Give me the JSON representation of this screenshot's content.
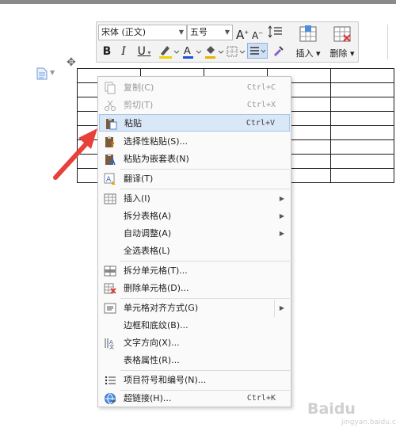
{
  "toolbar": {
    "font_name": "宋体 (正文)",
    "font_size": "五号",
    "grow_font": "A",
    "shrink_font": "A",
    "bold": "B",
    "italic": "I",
    "underline": "U",
    "insert_label": "插入",
    "delete_label": "删除"
  },
  "context_menu": {
    "copy": {
      "label": "复制(C)",
      "shortcut": "Ctrl+C"
    },
    "cut": {
      "label": "剪切(T)",
      "shortcut": "Ctrl+X"
    },
    "paste": {
      "label": "粘贴",
      "shortcut": "Ctrl+V"
    },
    "paste_special": {
      "label": "选择性粘贴(S)..."
    },
    "paste_nested": {
      "label": "粘贴为嵌套表(N)"
    },
    "translate": {
      "label": "翻译(T)"
    },
    "insert": {
      "label": "插入(I)"
    },
    "split_table": {
      "label": "拆分表格(A)"
    },
    "autofit": {
      "label": "自动调整(A)"
    },
    "select_table": {
      "label": "全选表格(L)"
    },
    "split_cells": {
      "label": "拆分单元格(T)..."
    },
    "delete_cells": {
      "label": "删除单元格(D)..."
    },
    "cell_alignment": {
      "label": "单元格对齐方式(G)"
    },
    "borders_shading": {
      "label": "边框和底纹(B)..."
    },
    "text_direction": {
      "label": "文字方向(X)..."
    },
    "table_properties": {
      "label": "表格属性(R)..."
    },
    "bullets_numbering": {
      "label": "项目符号和编号(N)..."
    },
    "hyperlink": {
      "label": "超链接(H)...",
      "shortcut": "Ctrl+K"
    }
  },
  "watermark": {
    "text": "Baidu",
    "sub": "jingyan.baidu.com"
  },
  "colors": {
    "highlight": "#d9e7f7",
    "annotation_arrow": "#e8403a",
    "font_color": "#1e4fd6",
    "highlight_color": "#f2d000"
  }
}
